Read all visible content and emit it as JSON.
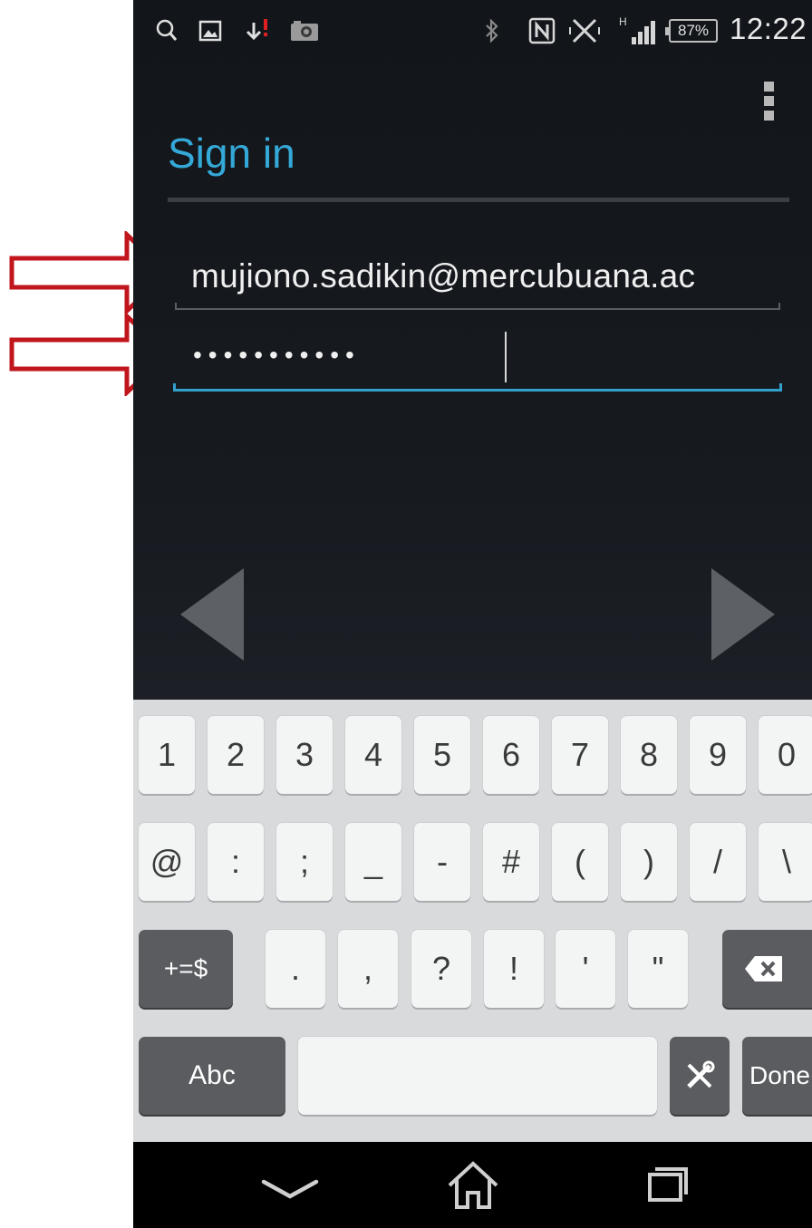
{
  "status_bar": {
    "icons": [
      "search-icon",
      "image-icon",
      "download-alert-icon",
      "camera-icon",
      "bluetooth-icon",
      "nfc-icon",
      "vibrate-icon",
      "signal-h-icon"
    ],
    "battery": "87%",
    "time": "12:22"
  },
  "header": {
    "title": "Sign in",
    "menu_icon": "overflow-menu-icon"
  },
  "form": {
    "email_value": "mujiono.sadikin@mercubuana.ac",
    "password_mask": "•••••••••••"
  },
  "navigation": {
    "prev": "previous-arrow-icon",
    "next": "next-arrow-icon"
  },
  "keyboard": {
    "row1": [
      "1",
      "2",
      "3",
      "4",
      "5",
      "6",
      "7",
      "8",
      "9",
      "0"
    ],
    "row2": [
      "@",
      ":",
      ";",
      "_",
      "-",
      "#",
      "(",
      ")",
      "/",
      "\\"
    ],
    "row3": [
      "+=$",
      ".",
      ",",
      "?",
      "!",
      "'",
      "\""
    ],
    "abc_label": "Abc",
    "done_label": "Done",
    "backspace_icon": "backspace-icon",
    "tools_icon": "tools-icon"
  },
  "nav_bar": {
    "back": "back-icon",
    "home": "home-icon",
    "recents": "recents-icon"
  },
  "colors": {
    "accent": "#34a9d8",
    "annotation": "#c0161c",
    "keyboard_bg": "#d8dadc"
  }
}
